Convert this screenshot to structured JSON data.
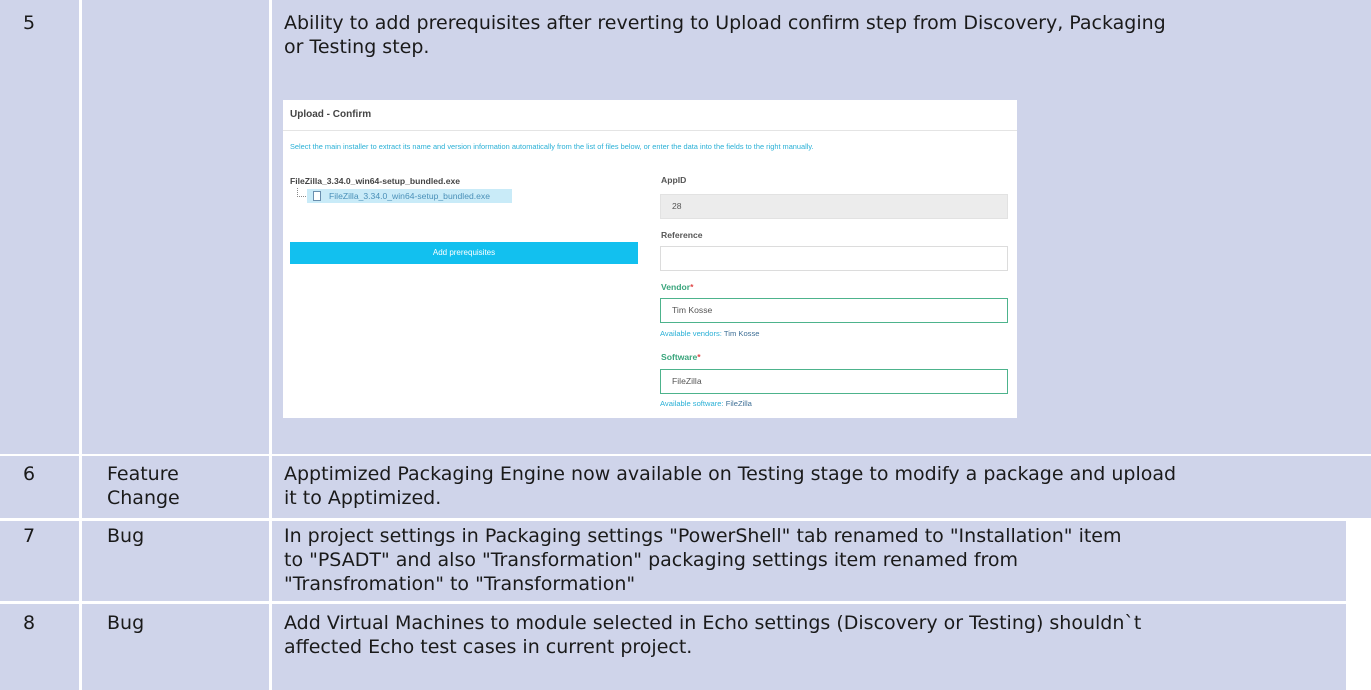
{
  "rows": [
    {
      "num": "5",
      "type": "",
      "desc_line1": "Ability to add prerequisites after reverting to Upload confirm step from Discovery, Packaging",
      "desc_line2": "or Testing step."
    },
    {
      "num": "6",
      "type_line1": "Feature",
      "type_line2": "Change",
      "desc_line1": "Apptimized Packaging Engine now available on Testing stage to modify a package and upload",
      "desc_line2": "it to Apptimized."
    },
    {
      "num": "7",
      "type": "Bug",
      "desc_line1": "In project settings in Packaging settings  \"PowerShell\" tab renamed to \"Installation\" item",
      "desc_line2": "to \"PSADT\" and also \"Transformation\" packaging settings item renamed from",
      "desc_line3": "\"Transfromation\" to \"Transformation\""
    },
    {
      "num": "8",
      "type": "Bug",
      "desc_line1": "Add Virtual Machines to module selected in Echo settings (Discovery or Testing) shouldn`t",
      "desc_line2": "affected Echo test cases in current project."
    }
  ],
  "screenshot": {
    "title": "Upload - Confirm",
    "info": "Select the main installer to extract its name and version information automatically from the list of files below, or enter the data into the fields to the right manually.",
    "file_root": "FileZilla_3.34.0_win64-setup_bundled.exe",
    "file_child": "FileZilla_3.34.0_win64-setup_bundled.exe",
    "add_button": "Add prerequisites",
    "appid_label": "AppID",
    "appid_value": "28",
    "reference_label": "Reference",
    "reference_value": "",
    "vendor_label": "Vendor",
    "vendor_value": "Tim Kosse",
    "vendor_hint": "Available vendors:",
    "vendor_hint_value": "Tim Kosse",
    "software_label": "Software",
    "software_value": "FileZilla",
    "software_hint": "Available software:",
    "software_hint_value": "FileZilla",
    "required_mark": "*",
    "accent_color": "#12c0ef",
    "valid_color": "#4db38c"
  }
}
